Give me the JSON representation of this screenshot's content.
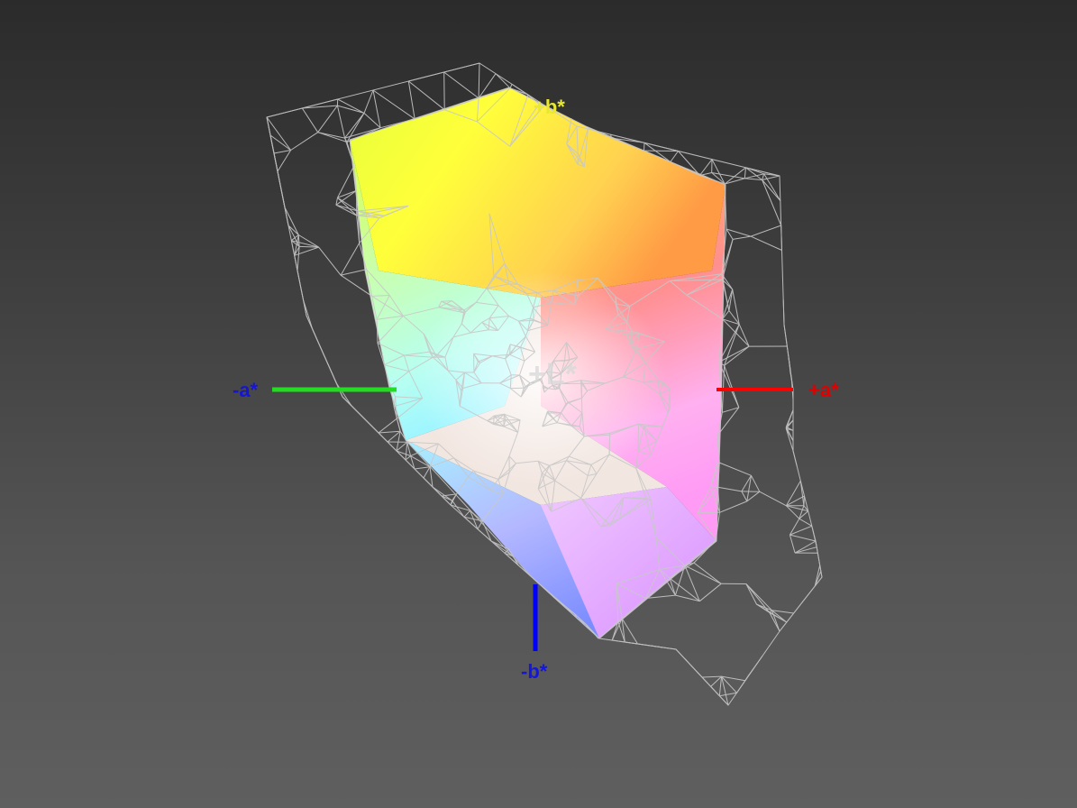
{
  "axes": {
    "plus_a": {
      "label": "+a*",
      "color": "#e00000"
    },
    "minus_a": {
      "label": "-a*",
      "color": "#1515d8"
    },
    "minus_b": {
      "label": "-b*",
      "color": "#1515e0"
    },
    "plus_b": {
      "label": "+b*",
      "color": "#e8e830"
    },
    "plus_l": {
      "label": "+L*",
      "color": "#d8d8d8"
    },
    "line_colors": {
      "plus_a": "#ff0000",
      "minus_a": "#22dd22",
      "minus_b": "#0000ff"
    }
  },
  "wireframe_color": "#c8c8c8"
}
